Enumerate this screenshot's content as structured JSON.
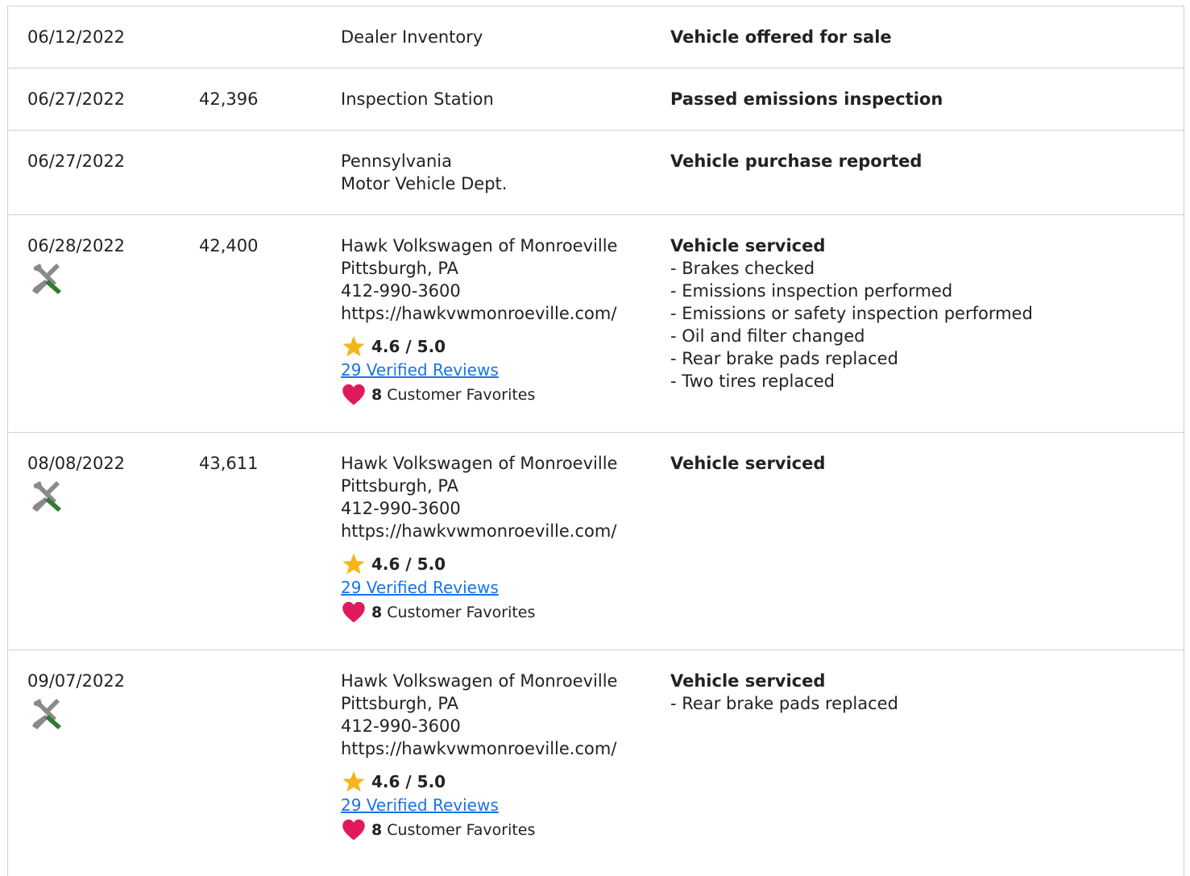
{
  "colors": {
    "border": "#cfcfcf",
    "link": "#1a73e8",
    "star": "#f5b51a",
    "heart": "#e0195a",
    "wrench": "#8a8a8a",
    "screwdriver_handle": "#2e7d32"
  },
  "records": [
    {
      "date": "06/12/2022",
      "mileage": "",
      "source": [
        "Dealer Inventory"
      ],
      "comment_title": "Vehicle offered for sale",
      "details": []
    },
    {
      "date": "06/27/2022",
      "mileage": "42,396",
      "source": [
        "Inspection Station"
      ],
      "comment_title": "Passed emissions inspection",
      "details": []
    },
    {
      "date": "06/27/2022",
      "mileage": "",
      "source": [
        "Pennsylvania",
        "Motor Vehicle Dept."
      ],
      "comment_title": "Vehicle purchase reported",
      "details": []
    },
    {
      "date": "06/28/2022",
      "mileage": "42,400",
      "service_icon": "service-tools-icon",
      "source": [
        "Hawk Volkswagen of Monroeville",
        "Pittsburgh, PA",
        "412-990-3600",
        "https://hawkvwmonroeville.com/"
      ],
      "rating": "4.6 / 5.0",
      "reviews": "29 Verified Reviews",
      "favorites_count": "8",
      "favorites_label": "Customer Favorites",
      "comment_title": "Vehicle serviced",
      "details": [
        "- Brakes checked",
        "- Emissions inspection performed",
        "- Emissions or safety inspection performed",
        "- Oil and filter changed",
        "- Rear brake pads replaced",
        "- Two tires replaced"
      ]
    },
    {
      "date": "08/08/2022",
      "mileage": "43,611",
      "service_icon": "service-tools-icon",
      "source": [
        "Hawk Volkswagen of Monroeville",
        "Pittsburgh, PA",
        "412-990-3600",
        "https://hawkvwmonroeville.com/"
      ],
      "rating": "4.6 / 5.0",
      "reviews": "29 Verified Reviews",
      "favorites_count": "8",
      "favorites_label": "Customer Favorites",
      "comment_title": "Vehicle serviced",
      "details": []
    },
    {
      "date": "09/07/2022",
      "mileage": "",
      "service_icon": "service-tools-icon",
      "source": [
        "Hawk Volkswagen of Monroeville",
        "Pittsburgh, PA",
        "412-990-3600",
        "https://hawkvwmonroeville.com/"
      ],
      "rating": "4.6 / 5.0",
      "reviews": "29 Verified Reviews",
      "favorites_count": "8",
      "favorites_label": "Customer Favorites",
      "comment_title": "Vehicle serviced",
      "details": [
        "- Rear brake pads replaced"
      ]
    }
  ]
}
